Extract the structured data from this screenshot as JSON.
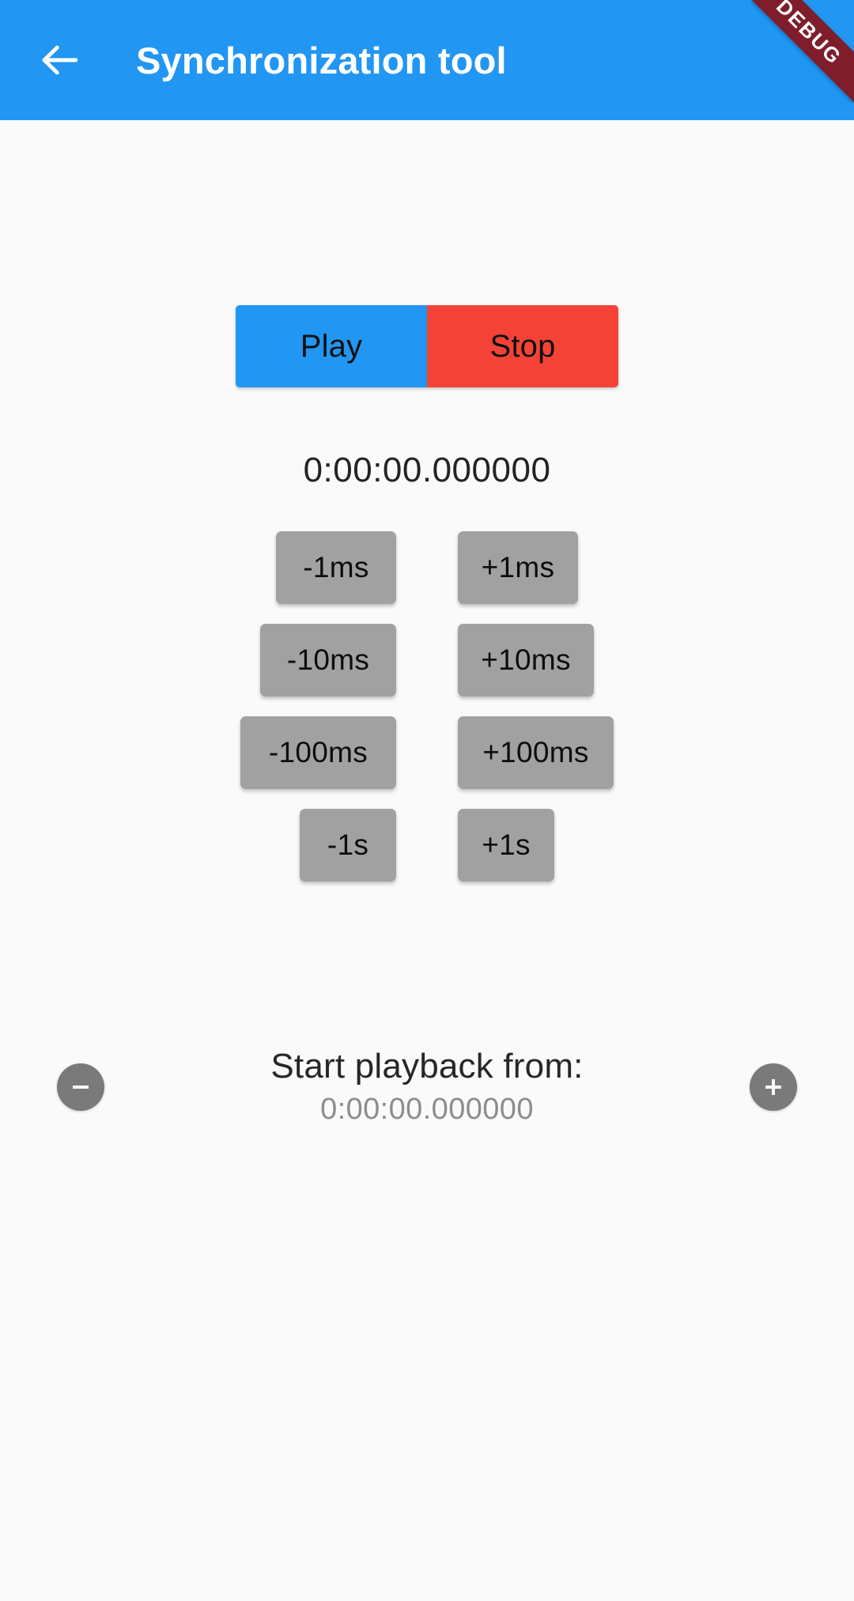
{
  "appbar": {
    "title": "Synchronization tool",
    "back_icon": "arrow-left-icon",
    "background_color": "#2196f3",
    "title_color": "#ffffff"
  },
  "corner_ribbon": {
    "label": "DEBUG",
    "color": "#7f1d2b",
    "text_color": "#ffffff"
  },
  "transport": {
    "play_label": "Play",
    "stop_label": "Stop",
    "play_color": "#2196f3",
    "stop_color": "#f44336"
  },
  "timer": {
    "current_time": "0:00:00.000000"
  },
  "offsets": {
    "button_color": "#a1a1a1",
    "rows": [
      {
        "negative": "-1ms",
        "positive": "+1ms",
        "width_class": "w-sm"
      },
      {
        "negative": "-10ms",
        "positive": "+10ms",
        "width_class": "w-md"
      },
      {
        "negative": "-100ms",
        "positive": "+100ms",
        "width_class": "w-lg"
      },
      {
        "negative": "-1s",
        "positive": "+1s",
        "width_class": "w-xl"
      }
    ]
  },
  "playback": {
    "label": "Start playback from:",
    "value": "0:00:00.000000",
    "decrease_icon": "minus-circle-icon",
    "increase_icon": "plus-circle-icon",
    "fab_color": "#7a7a7a"
  },
  "page": {
    "background_color": "#fafafa"
  }
}
